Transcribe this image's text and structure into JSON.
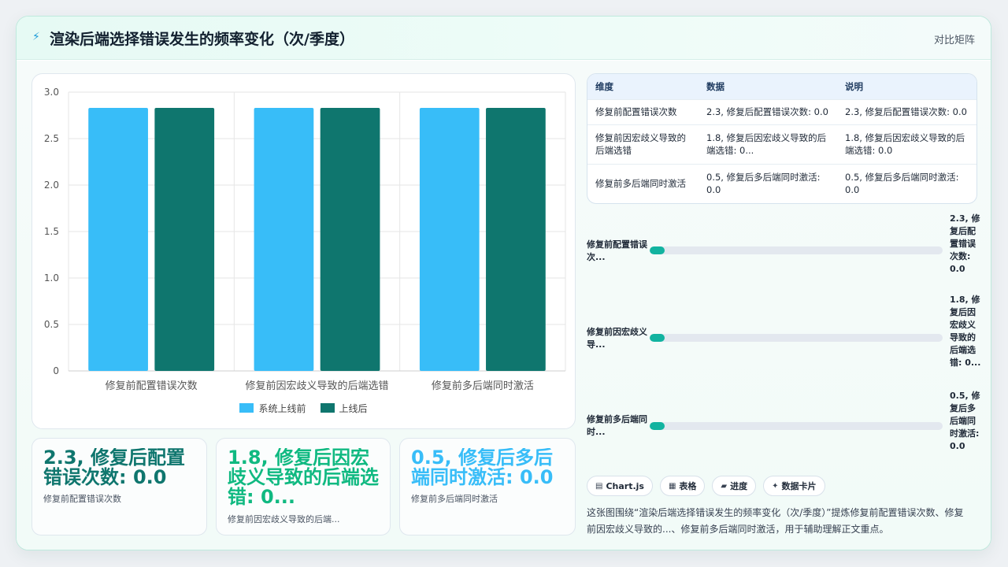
{
  "header": {
    "icon": "bolt-icon",
    "title": "渲染后端选择错误发生的频率变化（次/季度）",
    "badge": "对比矩阵"
  },
  "chart_data": {
    "type": "bar",
    "categories": [
      "修复前配置错误次数",
      "修复前因宏歧义导致的后端选错",
      "修复前多后端同时激活"
    ],
    "series": [
      {
        "name": "系统上线前",
        "color": "#38bdf8",
        "values": [
          2.83,
          2.83,
          2.83
        ]
      },
      {
        "name": "上线后",
        "color": "#0f766e",
        "values": [
          2.83,
          2.83,
          2.83
        ]
      }
    ],
    "yticks": [
      "0",
      "0.5",
      "1.0",
      "1.5",
      "2.0",
      "2.5",
      "3.0"
    ],
    "ylim": [
      0,
      3.0
    ],
    "grid": true,
    "legend_position": "bottom"
  },
  "stats": [
    {
      "value": "2.3, 修复后配置错误次数: 0.0",
      "label": "修复前配置错误次数",
      "color": "#0f766e"
    },
    {
      "value": "1.8, 修复后因宏歧义导致的后端选错: 0...",
      "label": "修复前因宏歧义导致的后端...",
      "color": "#10b981"
    },
    {
      "value": "0.5, 修复后多后端同时激活: 0.0",
      "label": "修复前多后端同时激活",
      "color": "#38bdf8"
    }
  ],
  "table": {
    "headers": [
      "维度",
      "数据",
      "说明"
    ],
    "rows": [
      [
        "修复前配置错误次数",
        "2.3, 修复后配置错误次数: 0.0",
        "2.3, 修复后配置错误次数: 0.0"
      ],
      [
        "修复前因宏歧义导致的后端选错",
        "1.8, 修复后因宏歧义导致的后端选错: 0...",
        "1.8, 修复后因宏歧义导致的后端选错: 0.0"
      ],
      [
        "修复前多后端同时激活",
        "0.5, 修复后多后端同时激活: 0.0",
        "0.5, 修复后多后端同时激活: 0.0"
      ]
    ]
  },
  "progress": [
    {
      "label": "修复前配置错误次...",
      "value": "2.3, 修复后配置错误次数: 0.0",
      "fraction": 0.05
    },
    {
      "label": "修复前因宏歧义导...",
      "value": "1.8, 修复后因宏歧义导致的后端选错: 0...",
      "fraction": 0.05
    },
    {
      "label": "修复前多后端同时...",
      "value": "0.5, 修复后多后端同时激活: 0.0",
      "fraction": 0.05
    }
  ],
  "chips": [
    {
      "icon": "chart-icon",
      "glyph": "▤",
      "label": "Chart.js"
    },
    {
      "icon": "table-icon",
      "glyph": "▦",
      "label": "表格"
    },
    {
      "icon": "progress-icon",
      "glyph": "▰",
      "label": "进度"
    },
    {
      "icon": "sparkle-icon",
      "glyph": "✦",
      "label": "数据卡片"
    }
  ],
  "description": "这张图围绕“渲染后端选择错误发生的频率变化（次/季度）”提炼修复前配置错误次数、修复前因宏歧义导致的...、修复前多后端同时激活，用于辅助理解正文重点。"
}
